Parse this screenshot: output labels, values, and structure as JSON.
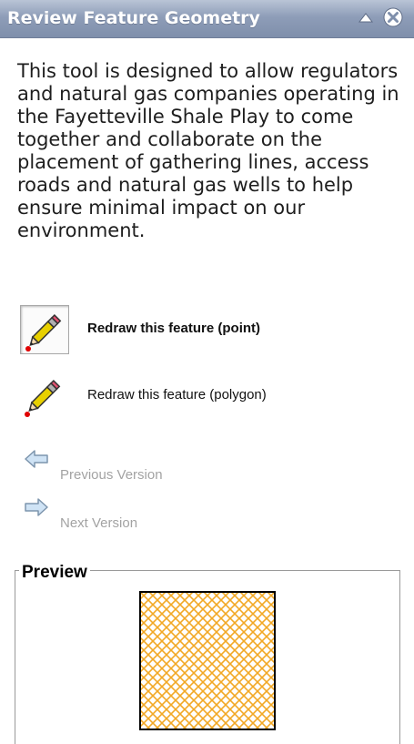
{
  "panel": {
    "title": "Review Feature Geometry",
    "collapse_icon": "triangle-up-icon",
    "close_icon": "close-circle-icon"
  },
  "description": "This tool is designed to allow regulators and natural gas companies operating in the Fayetteville Shale Play to come together and collaborate on the placement of gathering lines, access roads and natural gas wells to help ensure minimal impact on our environment.",
  "tools": {
    "redraw_point": {
      "label": "Redraw this feature (point)",
      "icon": "pencil-icon",
      "selected": true
    },
    "redraw_polygon": {
      "label": "Redraw this feature (polygon)",
      "icon": "pencil-icon",
      "selected": false
    }
  },
  "navigation": {
    "previous": {
      "label": "Previous Version",
      "icon": "arrow-left-icon"
    },
    "next": {
      "label": "Next Version",
      "icon": "arrow-right-icon"
    }
  },
  "preview": {
    "legend": "Preview",
    "fill_pattern_color": "#f2a825",
    "outline_color": "#000000"
  },
  "colors": {
    "titlebar": "#8e9db8",
    "title_text": "#ffffff",
    "disabled_text": "#a3a3a3",
    "arrow_fill": "#cfe3f5",
    "arrow_stroke": "#7d95ad"
  }
}
